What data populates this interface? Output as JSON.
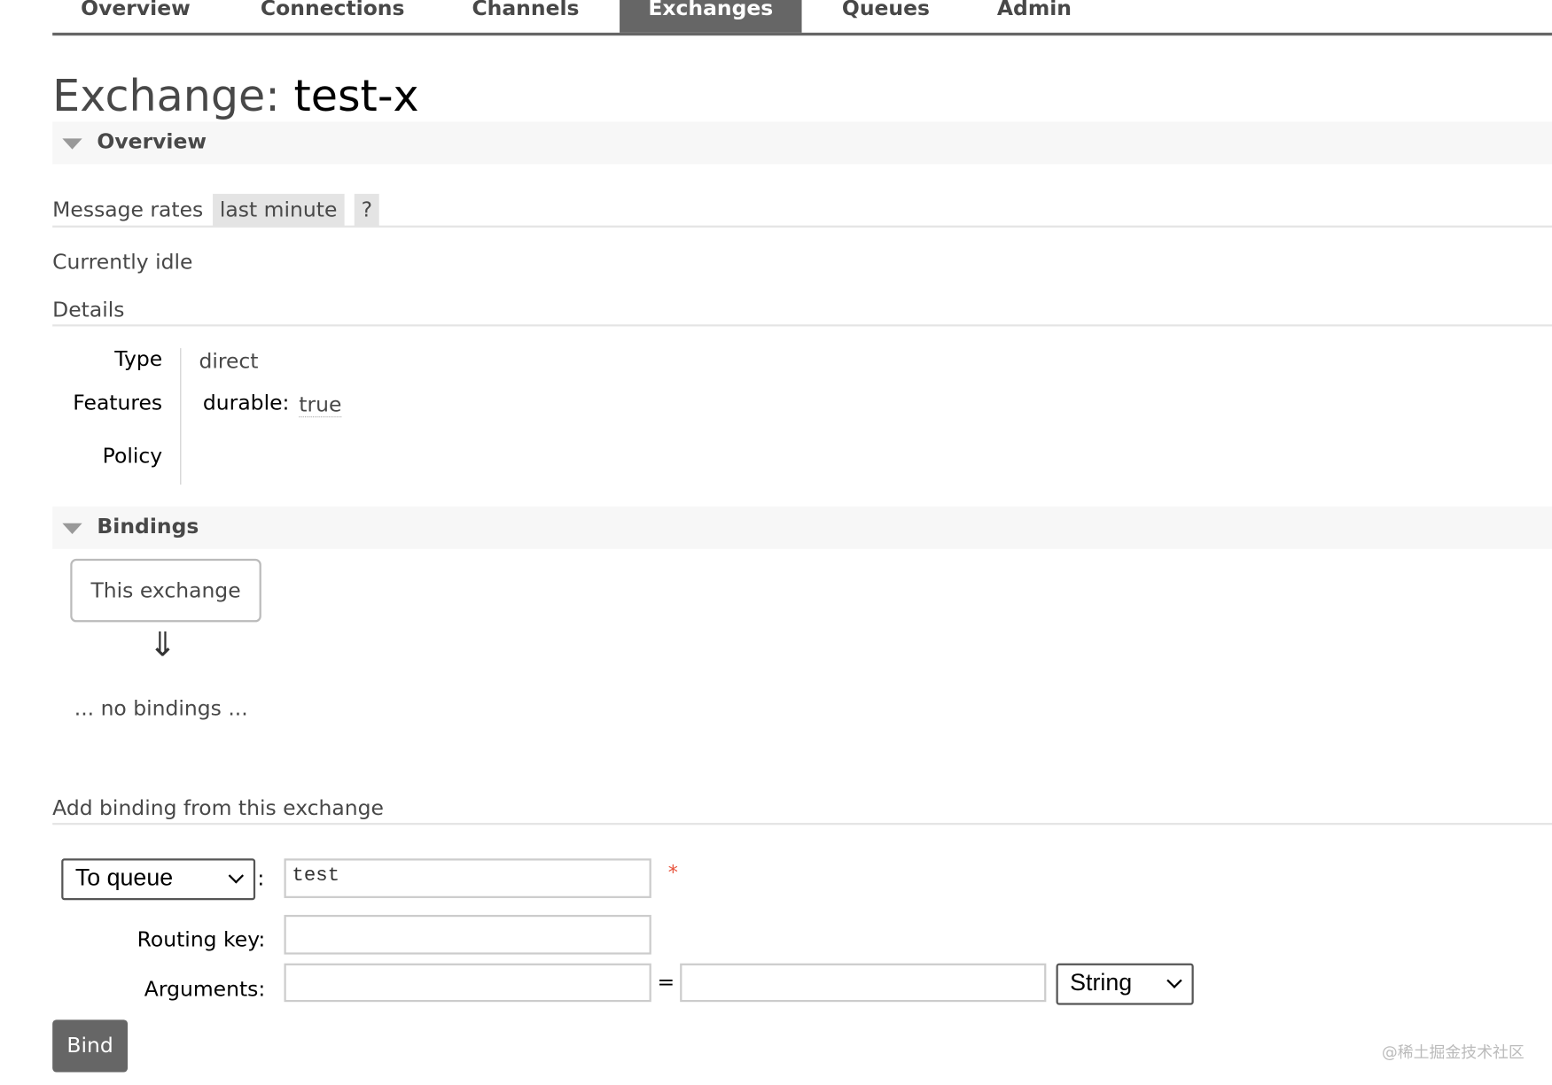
{
  "nav": {
    "tabs": [
      {
        "label": "Overview"
      },
      {
        "label": "Connections"
      },
      {
        "label": "Channels"
      },
      {
        "label": "Exchanges",
        "active": true
      },
      {
        "label": "Queues"
      },
      {
        "label": "Admin"
      }
    ]
  },
  "page": {
    "title_prefix": "Exchange:",
    "title_name": "test-x"
  },
  "overview": {
    "heading": "Overview",
    "message_rates_label": "Message rates",
    "rate_period": "last minute",
    "help": "?",
    "status": "Currently idle",
    "details_heading": "Details",
    "details": {
      "type_label": "Type",
      "type_value": "direct",
      "features_label": "Features",
      "feature_key": "durable:",
      "feature_value": "true",
      "policy_label": "Policy"
    }
  },
  "bindings": {
    "heading": "Bindings",
    "source_box": "This exchange",
    "arrow": "⇓",
    "empty": "... no bindings ..."
  },
  "add_binding": {
    "heading": "Add binding from this exchange",
    "destination_type": "To queue",
    "colon": ":",
    "destination_value": "test",
    "required_mark": "*",
    "routing_key_label": "Routing key:",
    "routing_key_value": "",
    "arguments_label": "Arguments:",
    "arg_key": "",
    "equals": "=",
    "arg_value": "",
    "arg_type": "String",
    "bind_label": "Bind"
  },
  "watermark": "@稀土掘金技术社区",
  "colors": {
    "active_tab": "#666666",
    "section_bg": "#f7f7f7",
    "required": "#e8553e"
  }
}
